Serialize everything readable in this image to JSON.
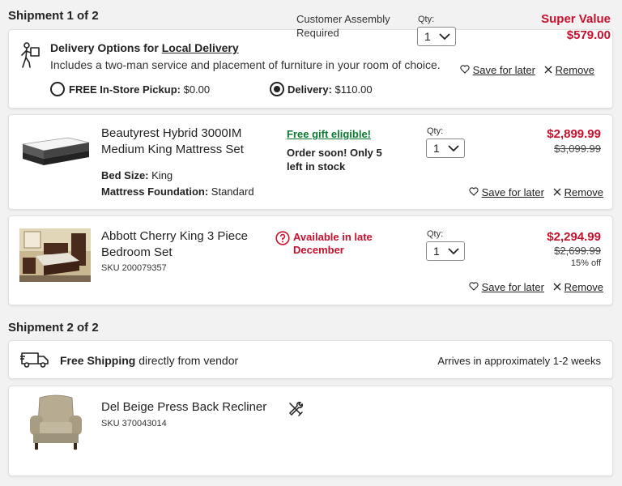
{
  "shipment1": {
    "heading": "Shipment 1 of 2",
    "delivery": {
      "title_prefix": "Delivery Options for ",
      "title_link": "Local Delivery",
      "description": "Includes a two-man service and placement of furniture in your room of choice.",
      "pickup_label": "FREE In-Store Pickup:",
      "pickup_price": "$0.00",
      "delivery_label": "Delivery:",
      "delivery_price": "$110.00"
    }
  },
  "items": [
    {
      "name_line1": "Beautyrest Hybrid 3000IM",
      "name_line2": "Medium King Mattress Set",
      "spec1_label": "Bed Size:",
      "spec1_value": "King",
      "spec2_label": "Mattress Foundation:",
      "spec2_value": "Standard",
      "promo": "Free gift eligible!",
      "stock_line1": "Order soon! Only 5",
      "stock_line2": "left in stock",
      "qty_label": "Qty:",
      "qty": "1",
      "price": "$2,899.99",
      "old_price": "$3,099.99",
      "save_label": "Save for later",
      "remove_label": "Remove"
    },
    {
      "name_line1": "Abbott Cherry King 3 Piece",
      "name_line2": "Bedroom Set",
      "sku": "SKU 200079357",
      "availability_line1": "Available in late",
      "availability_line2": "December",
      "qty_label": "Qty:",
      "qty": "1",
      "price": "$2,294.99",
      "old_price": "$2,699.99",
      "discount": "15% off",
      "save_label": "Save for later",
      "remove_label": "Remove"
    },
    {
      "name": "Del Beige Press Back Recliner",
      "sku": "SKU 370043014",
      "assembly_line1": "Customer Assembly",
      "assembly_line2": "Required",
      "qty_label": "Qty:",
      "qty": "1",
      "price_label": "Super Value",
      "price": "$579.00",
      "save_label": "Save for later",
      "remove_label": "Remove"
    }
  ],
  "shipment2": {
    "heading": "Shipment 2 of 2",
    "shipping_bold": "Free Shipping",
    "shipping_rest": " directly from vendor",
    "arrival": "Arrives in approximately 1-2 weeks"
  },
  "icons": {
    "delivery": "delivery-person-icon",
    "truck": "truck-icon",
    "question": "question-circle-icon",
    "tools": "tools-icon",
    "heart": "heart-icon",
    "close": "close-icon",
    "chevron": "chevron-down-icon"
  },
  "colors": {
    "accent_red": "#c8102e",
    "promo_green": "#0b7a2f"
  }
}
